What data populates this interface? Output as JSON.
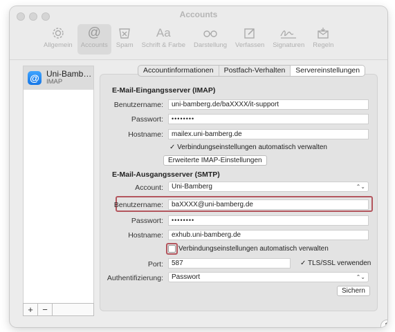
{
  "window": {
    "title": "Accounts"
  },
  "toolbar": {
    "items": [
      {
        "label": "Allgemein",
        "icon": "gear-icon",
        "glyph": "⚙"
      },
      {
        "label": "Accounts",
        "icon": "at-icon",
        "glyph": "@"
      },
      {
        "label": "Spam",
        "icon": "junk-icon",
        "glyph": "☒"
      },
      {
        "label": "Schrift & Farbe",
        "icon": "font-icon",
        "glyph": "Aa"
      },
      {
        "label": "Darstellung",
        "icon": "glasses-icon",
        "glyph": "oo"
      },
      {
        "label": "Verfassen",
        "icon": "compose-icon",
        "glyph": "✎"
      },
      {
        "label": "Signaturen",
        "icon": "signature-icon",
        "glyph": "✍"
      },
      {
        "label": "Regeln",
        "icon": "rules-icon",
        "glyph": "✉"
      }
    ]
  },
  "sidebar": {
    "account": {
      "name": "Uni-Bamb…",
      "type": "IMAP",
      "icon": "@"
    },
    "add": "+",
    "remove": "−"
  },
  "tabs": [
    "Accountinformationen",
    "Postfach-Verhalten",
    "Servereinstellungen"
  ],
  "imap": {
    "heading": "E-Mail-Eingangsserver (IMAP)",
    "user_label": "Benutzername:",
    "user_value": "uni-bamberg.de/baXXXX/it-support",
    "pass_label": "Passwort:",
    "pass_value": "••••••••",
    "host_label": "Hostname:",
    "host_value": "mailex.uni-bamberg.de",
    "auto_manage": "✓ Verbindungseinstellungen automatisch verwalten",
    "advanced_button": "Erweiterte IMAP-Einstellungen"
  },
  "smtp": {
    "heading": "E-Mail-Ausgangsserver (SMTP)",
    "account_label": "Account:",
    "account_value": "Uni-Bamberg",
    "user_label": "Benutzername:",
    "user_value": "baXXXX@uni-bamberg.de",
    "pass_label": "Passwort:",
    "pass_value": "••••••••",
    "host_label": "Hostname:",
    "host_value": "exhub.uni-bamberg.de",
    "auto_manage": "Verbindungseinstellungen automatisch verwalten",
    "port_label": "Port:",
    "port_value": "587",
    "tls": "✓ TLS/SSL verwenden",
    "auth_label": "Authentifizierung:",
    "auth_value": "Passwort"
  },
  "save_button": "Sichern",
  "help": "?",
  "select_chevron": "⌃⌄",
  "colors": {
    "highlight": "#b3555d",
    "accent": "#1576e6"
  }
}
